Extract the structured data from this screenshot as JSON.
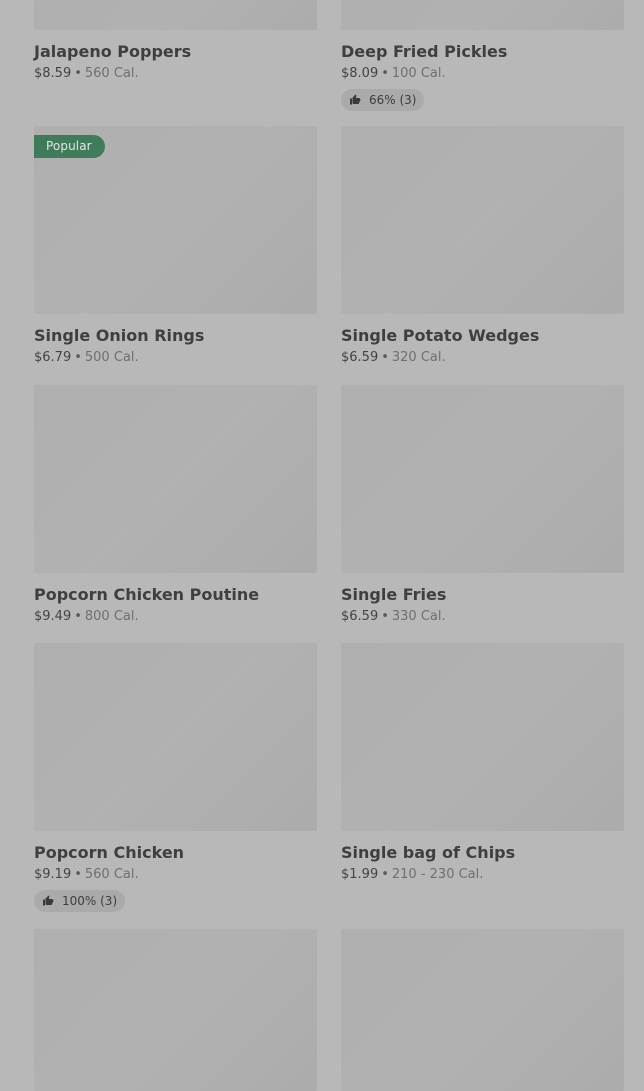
{
  "items": [
    {
      "name": "Jalapeno Poppers",
      "price": "$8.59",
      "calories": "560 Cal.",
      "badge": "",
      "rating": ""
    },
    {
      "name": "Deep Fried Pickles",
      "price": "$8.09",
      "calories": "100 Cal.",
      "badge": "",
      "rating": "66% (3)"
    },
    {
      "name": "Single Onion Rings",
      "price": "$6.79",
      "calories": "500 Cal.",
      "badge": "Popular",
      "rating": ""
    },
    {
      "name": "Single Potato Wedges",
      "price": "$6.59",
      "calories": "320 Cal.",
      "badge": "",
      "rating": ""
    },
    {
      "name": "Popcorn Chicken Poutine",
      "price": "$9.49",
      "calories": "800 Cal.",
      "badge": "",
      "rating": ""
    },
    {
      "name": "Single Fries",
      "price": "$6.59",
      "calories": "330 Cal.",
      "badge": "",
      "rating": ""
    },
    {
      "name": "Popcorn Chicken",
      "price": "$9.19",
      "calories": "560 Cal.",
      "badge": "",
      "rating": "100% (3)"
    },
    {
      "name": "Single bag of Chips",
      "price": "$1.99",
      "calories": "210 - 230 Cal.",
      "badge": "",
      "rating": ""
    }
  ],
  "separator": "•",
  "icons": {
    "rating": "thumbs-up-icon"
  },
  "colors": {
    "badge_bg": "#3f7a5a",
    "badge_text": "#dde9e1",
    "rating_bg": "#aaaaaa"
  }
}
